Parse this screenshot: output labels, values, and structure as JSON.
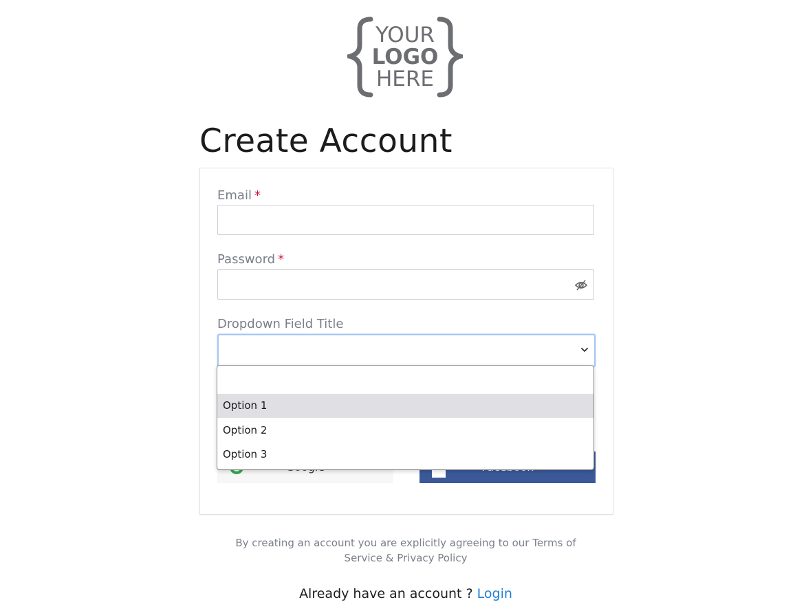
{
  "logo": {
    "line1": "YOUR",
    "line2": "LOGO",
    "line3": "HERE",
    "color": "#6d6e71"
  },
  "page_title": "Create Account",
  "form": {
    "email": {
      "label": "Email",
      "required_mark": "*",
      "value": ""
    },
    "password": {
      "label": "Password",
      "required_mark": "*",
      "value": "",
      "toggle_icon": "eye-slash-icon"
    },
    "dropdown": {
      "label": "Dropdown Field Title",
      "selected": "",
      "expanded": true,
      "options": [
        "",
        "Option 1",
        "Option 2",
        "Option 3"
      ],
      "highlighted": "Option 1"
    },
    "social": {
      "google_label": "Google",
      "facebook_label": "Facebook",
      "facebook_color": "#3b5998"
    }
  },
  "footer": {
    "terms_text": "By creating an account you are explicitly agreeing to our Terms of Service & Privacy Policy",
    "already_text": "Already have an account ? ",
    "login_label": "Login",
    "link_color": "#1f7fd6"
  }
}
